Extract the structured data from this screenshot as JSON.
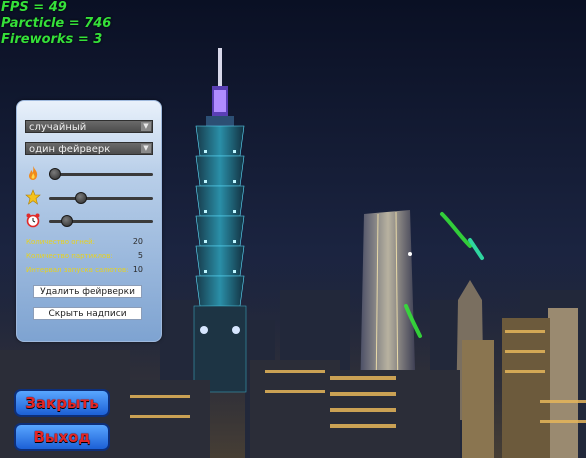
{
  "stats": {
    "fps": "FPS = 49",
    "particles": "Parcticle = 746",
    "fireworks": "Fireworks = 3"
  },
  "panel": {
    "mode_select": "случайный",
    "type_select": "один фейрверк",
    "sliders": [
      {
        "icon": "fire-icon",
        "value": 0.0
      },
      {
        "icon": "star-icon",
        "value": 0.28
      },
      {
        "icon": "alarm-clock-icon",
        "value": 0.13
      }
    ],
    "fires_label": "Количество огней:",
    "fires_value": "20",
    "particles_label": "Количество партиклов:",
    "particles_value": "5",
    "interval_label": "Интервал запуска салютов:",
    "interval_value": "10",
    "delete_button": "Удалить фейрверки",
    "hide_button": "Скрыть надписи"
  },
  "buttons": {
    "close": "Закрыть",
    "exit": "Выход"
  },
  "colors": {
    "stats_text": "#35e03a",
    "panel_top": "#e9f1fb",
    "panel_bottom": "#7ea3d1",
    "big_button": "#2f7ff0",
    "big_button_text": "#e32626",
    "firework_green": "#35e03a",
    "firework_teal": "#2fd6a0"
  }
}
